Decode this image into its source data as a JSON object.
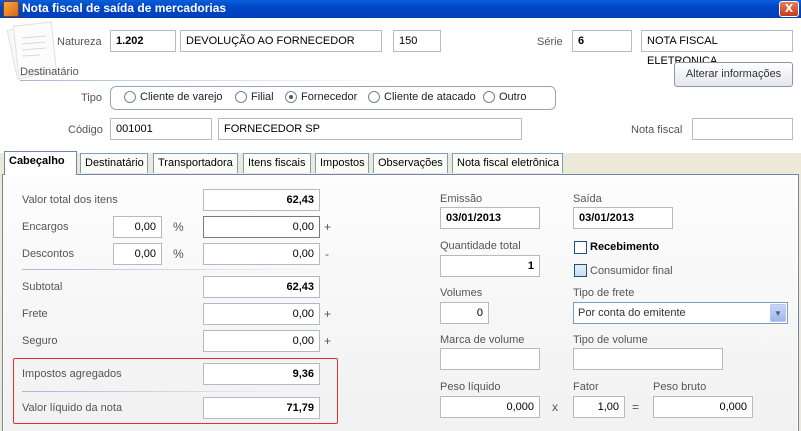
{
  "window": {
    "title": "Nota fiscal de saída de mercadorias",
    "close_label": "X"
  },
  "header": {
    "natureza_label": "Natureza",
    "natureza_code": "1.202",
    "natureza_desc": "DEVOLUÇÃO AO FORNECEDOR",
    "natureza_num": "150",
    "serie_label": "Série",
    "serie_code": "6",
    "serie_desc": "NOTA FISCAL ELETRONICA",
    "destinatario_label": "Destinatário",
    "alterar_button": "Alterar informações",
    "tipo_label": "Tipo",
    "tipo_options": [
      {
        "label": "Cliente de varejo",
        "selected": false
      },
      {
        "label": "Filial",
        "selected": false
      },
      {
        "label": "Fornecedor",
        "selected": true
      },
      {
        "label": "Cliente de atacado",
        "selected": false
      },
      {
        "label": "Outro",
        "selected": false
      }
    ],
    "codigo_label": "Código",
    "codigo_value": "001001",
    "codigo_name": "FORNECEDOR SP",
    "nota_fiscal_label": "Nota fiscal",
    "nota_fiscal_value": ""
  },
  "tabs": [
    {
      "label": "Cabeçalho",
      "active": true
    },
    {
      "label": "Destinatário",
      "active": false
    },
    {
      "label": "Transportadora",
      "active": false
    },
    {
      "label": "Itens fiscais",
      "active": false
    },
    {
      "label": "Impostos",
      "active": false
    },
    {
      "label": "Observações",
      "active": false
    },
    {
      "label": "Nota fiscal eletrônica",
      "active": false
    }
  ],
  "totals": {
    "valor_total_itens_label": "Valor total dos itens",
    "valor_total_itens": "62,43",
    "encargos_label": "Encargos",
    "encargos_pct": "0,00",
    "encargos_value": "0,00",
    "descontos_label": "Descontos",
    "descontos_pct": "0,00",
    "descontos_value": "0,00",
    "percent_symbol": "%",
    "plus_symbol": "+",
    "minus_symbol": "-",
    "subtotal_label": "Subtotal",
    "subtotal": "62,43",
    "frete_label": "Frete",
    "frete": "0,00",
    "seguro_label": "Seguro",
    "seguro": "0,00",
    "impostos_label": "Impostos agregados",
    "impostos": "9,36",
    "valor_liquido_label": "Valor líquido da nota",
    "valor_liquido": "71,79"
  },
  "details": {
    "emissao_label": "Emissão",
    "emissao": "03/01/2013",
    "saida_label": "Saída",
    "saida": "03/01/2013",
    "quantidade_label": "Quantidade total",
    "quantidade": "1",
    "recebimento_label": "Recebimento",
    "consumidor_label": "Consumidor final",
    "volumes_label": "Volumes",
    "volumes": "0",
    "tipo_frete_label": "Tipo de frete",
    "tipo_frete": "Por conta do emitente",
    "marca_label": "Marca de volume",
    "marca": "",
    "tipo_volume_label": "Tipo de volume",
    "tipo_volume": "",
    "peso_liquido_label": "Peso líquido",
    "peso_liquido": "0,000",
    "times_symbol": "x",
    "fator_label": "Fator",
    "fator": "1,00",
    "equals_symbol": "=",
    "peso_bruto_label": "Peso bruto",
    "peso_bruto": "0,000"
  },
  "colors": {
    "titlebar": "#0046c9",
    "highlight_border": "#dd3333",
    "active_tab_border": "#6f88a8"
  }
}
